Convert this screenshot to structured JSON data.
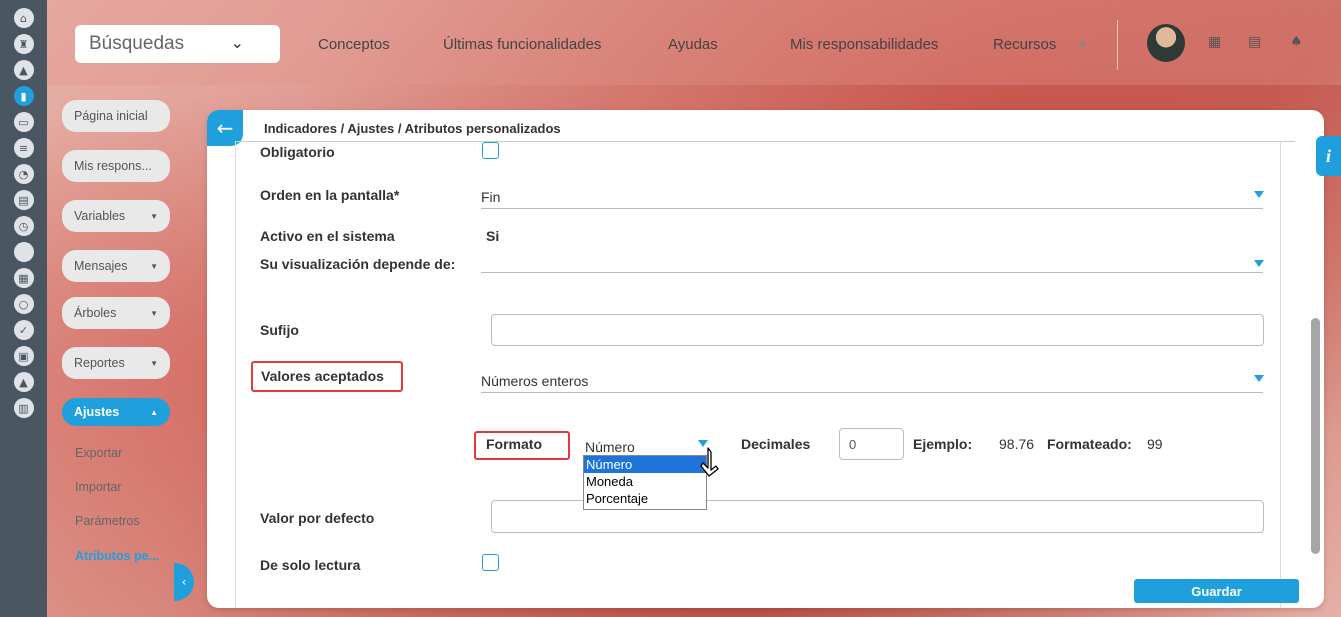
{
  "search": {
    "label": "Búsquedas"
  },
  "nav": [
    "Conceptos",
    "Últimas funcionalidades",
    "Ayudas",
    "Mis responsabilidades",
    "Recursos"
  ],
  "sidebar": {
    "items": [
      "Página inicial",
      "Mis respons...",
      "Variables",
      "Mensajes",
      "Árboles",
      "Reportes"
    ],
    "active": "Ajustes",
    "subitems": [
      "Exportar",
      "Importar",
      "Parámetros",
      "Atributos pe..."
    ]
  },
  "breadcrumb": "Indicadores / Ajustes / Atributos personalizados",
  "form": {
    "obligatorio": "Obligatorio",
    "orden_label": "Orden en la pantalla*",
    "orden_value": "Fin",
    "activo_label": "Activo en el sistema",
    "activo_value": "Si",
    "depende_label": "Su visualización depende de:",
    "sufijo_label": "Sufijo",
    "valores_label": "Valores aceptados",
    "valores_value": "Números enteros",
    "formato_label": "Formato",
    "formato_value": "Número",
    "decimales_label": "Decimales",
    "decimales_value": "0",
    "ejemplo_label": "Ejemplo:",
    "ejemplo_value": "98.76",
    "formateado_label": "Formateado:",
    "formateado_value": "99",
    "defecto_label": "Valor por defecto",
    "lectura_label": "De solo lectura"
  },
  "dropdown_options": [
    "Número",
    "Moneda",
    "Porcentaje"
  ],
  "save_label": "Guardar",
  "info_label": "i",
  "colors": {
    "accent": "#1fa0dd",
    "highlight": "#e03a3a",
    "leftbar": "#4a5662"
  }
}
